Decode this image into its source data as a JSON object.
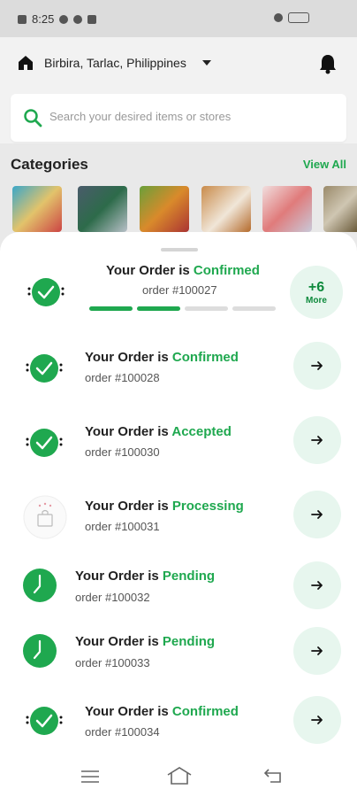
{
  "status_bar": {
    "time": "8:25"
  },
  "location": {
    "text": "Birbira, Tarlac, Philippines"
  },
  "search": {
    "placeholder": "Search your desired items or stores"
  },
  "categories": {
    "title": "Categories",
    "view_all": "View All"
  },
  "orders": [
    {
      "prefix": "Your Order is",
      "status": "Confirmed",
      "number": "order #100027"
    },
    {
      "prefix": "Your Order is",
      "status": "Confirmed",
      "number": "order #100028"
    },
    {
      "prefix": "Your Order is",
      "status": "Accepted",
      "number": "order #100030"
    },
    {
      "prefix": "Your Order is",
      "status": "Processing",
      "number": "order #100031"
    },
    {
      "prefix": "Your Order is",
      "status": "Pending",
      "number": "order #100032"
    },
    {
      "prefix": "Your Order is",
      "status": "Pending",
      "number": "order #100033"
    },
    {
      "prefix": "Your Order is",
      "status": "Confirmed",
      "number": "order #100034"
    }
  ],
  "more": {
    "count": "+6",
    "label": "More"
  },
  "progress_steps": {
    "total": 4,
    "completed": 2
  },
  "colors": {
    "accent": "#1fa84f",
    "accent_light": "#e7f6ee"
  }
}
